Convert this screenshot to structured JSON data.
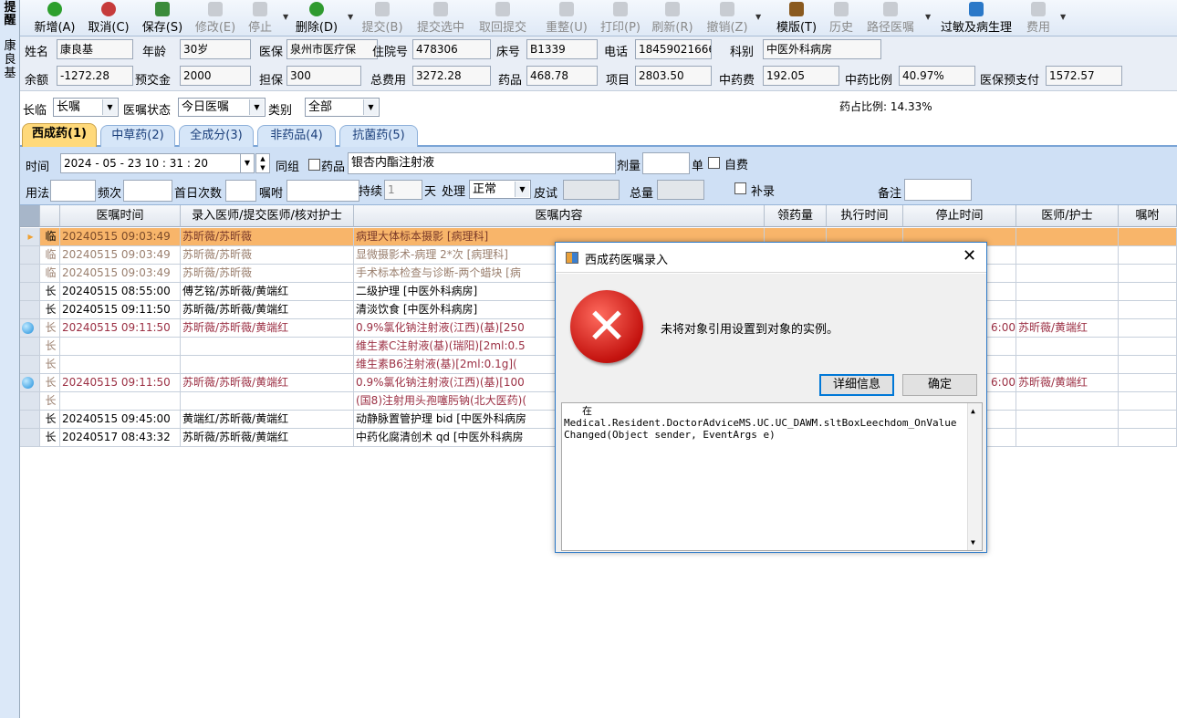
{
  "sidebar": {
    "chars_top": [
      "提",
      "醒"
    ],
    "patient_chars": [
      "康",
      "良",
      "基"
    ]
  },
  "toolbar": {
    "buttons": [
      {
        "label": "新增(A)",
        "color": "#2d9f2d"
      },
      {
        "label": "取消(C)",
        "color": "#c63b3b"
      },
      {
        "label": "保存(S)",
        "color": "#3a8b3a"
      },
      {
        "label": "修改(E)",
        "color": "#c8ccd2"
      },
      {
        "label": "停止",
        "color": "#c8ccd2"
      },
      {
        "label": "删除(D)",
        "color": "#2f9a2f"
      },
      {
        "label": "提交(B)",
        "color": "#c8ccd2"
      },
      {
        "label": "提交选中",
        "color": "#c8ccd2"
      },
      {
        "label": "取回提交",
        "color": "#c8ccd2"
      },
      {
        "label": "重整(U)",
        "color": "#c8ccd2"
      },
      {
        "label": "打印(P)",
        "color": "#c8ccd2"
      },
      {
        "label": "刷新(R)",
        "color": "#c8ccd2"
      },
      {
        "label": "撤销(Z)",
        "color": "#c8ccd2"
      },
      {
        "label": "模版(T)",
        "color": "#8a5a1f"
      },
      {
        "label": "历史",
        "color": "#c8ccd2"
      },
      {
        "label": "路径医嘱",
        "color": "#c8ccd2"
      },
      {
        "label": "过敏及病生理",
        "color": "#2a78c8"
      },
      {
        "label": "费用",
        "color": "#c8ccd2"
      }
    ]
  },
  "patient": {
    "name_label": "姓名",
    "name": "康良基",
    "age_label": "年龄",
    "age": "30岁",
    "insurance_label": "医保",
    "insurance": "泉州市医疗保",
    "admission_label": "住院号",
    "admission_no": "478306",
    "bed_label": "床号",
    "bed": "B1339",
    "phone_label": "电话",
    "phone": "18459021666",
    "dept_label": "科别",
    "dept": "中医外科病房",
    "balance_label": "余额",
    "balance": "-1272.28",
    "deposit_label": "预交金",
    "deposit": "2000",
    "guarantee_label": "担保",
    "guarantee": "300",
    "total_label": "总费用",
    "total": "3272.28",
    "drug_label": "药品",
    "drug": "468.78",
    "item_label": "项目",
    "item": "2803.50",
    "tcm_label": "中药费",
    "tcm": "192.05",
    "tcm_ratio_label": "中药比例",
    "tcm_ratio": "40.97%",
    "prepay_label": "医保预支付",
    "prepay": "1572.57"
  },
  "filter": {
    "type_label": "长临",
    "type_value": "长嘱",
    "status_label": "医嘱状态",
    "status_value": "今日医嘱",
    "category_label": "类别",
    "category_value": "全部",
    "drug_ratio": "药占比例: 14.33%"
  },
  "tabs": [
    "西成药(1)",
    "中草药(2)",
    "全成分(3)",
    "非药品(4)",
    "抗菌药(5)"
  ],
  "entry": {
    "time_label": "时间",
    "time_value": "2024 - 05 - 23    10 : 31 : 20",
    "group_label": "同组",
    "drug_label": "药品",
    "drug_value": "银杏内酯注射液",
    "dose_label": "剂量",
    "unit_label": "单",
    "selfpay_label": "自费",
    "usage_label": "用法",
    "freq_label": "频次",
    "firstday_label": "首日次数",
    "remark_label": "嘱咐",
    "duration_label": "持续",
    "duration_value": "1",
    "day_label": "天",
    "handle_label": "处理",
    "handle_value": "正常",
    "skintest_label": "皮试",
    "total_label": "总量",
    "supplement_label": "补录",
    "note_label": "备注"
  },
  "grid": {
    "headers": [
      "",
      "",
      "医嘱时间",
      "录入医师/提交医师/核对护士",
      "医嘱内容",
      "领药量",
      "执行时间",
      "停止时间",
      "医师/护士",
      "嘱咐"
    ],
    "rows": [
      {
        "type": "临",
        "time": "20240515 09:03:49",
        "doctor": "苏昕薇/苏昕薇",
        "content": "病理大体标本摄影  [病理科]",
        "selected": true
      },
      {
        "type": "临",
        "time": "20240515 09:03:49",
        "doctor": "苏昕薇/苏昕薇",
        "content": "显微摄影术-病理  2*次  [病理科]",
        "gray": true
      },
      {
        "type": "临",
        "time": "20240515 09:03:49",
        "doctor": "苏昕薇/苏昕薇",
        "content": "手术标本检查与诊断-两个蜡块  [病",
        "gray": true
      },
      {
        "type": "长",
        "time": "20240515 08:55:00",
        "doctor": "傅艺铭/苏昕薇/黄端红",
        "content": "二级护理  [中医外科病房]"
      },
      {
        "type": "长",
        "time": "20240515 09:11:50",
        "doctor": "苏昕薇/苏昕薇/黄端红",
        "content": "清淡饮食  [中医外科病房]"
      },
      {
        "type": "长",
        "time": "20240515 09:11:50",
        "doctor": "苏昕薇/苏昕薇/黄端红",
        "content": "0.9%氯化钠注射液(江西)(基)[250",
        "maroon": true,
        "bullet": true,
        "nurse": "苏昕薇/黄端红",
        "stop": "6:00"
      },
      {
        "type": "长",
        "time": "",
        "doctor": "",
        "content": "维生素C注射液(基)(瑞阳)[2ml:0.5",
        "maroon": true
      },
      {
        "type": "长",
        "time": "",
        "doctor": "",
        "content": "维生素B6注射液(基)[2ml:0.1g](",
        "maroon": true
      },
      {
        "type": "长",
        "time": "20240515 09:11:50",
        "doctor": "苏昕薇/苏昕薇/黄端红",
        "content": "0.9%氯化钠注射液(江西)(基)[100",
        "maroon": true,
        "bullet": true,
        "nurse": "苏昕薇/黄端红",
        "stop": "6:00"
      },
      {
        "type": "长",
        "time": "",
        "doctor": "",
        "content": "(国8)注射用头孢噻肟钠(北大医药)(",
        "maroon": true
      },
      {
        "type": "长",
        "time": "20240515 09:45:00",
        "doctor": "黄端红/苏昕薇/黄端红",
        "content": "动静脉置管护理 bid  [中医外科病房"
      },
      {
        "type": "长",
        "time": "20240517 08:43:32",
        "doctor": "苏昕薇/苏昕薇/黄端红",
        "content": "中药化腐清创术 qd  [中医外科病房"
      }
    ]
  },
  "dialog": {
    "title": "西成药医嘱录入",
    "message": "未将对象引用设置到对象的实例。",
    "details_button": "详细信息",
    "ok_button": "确定",
    "stack_line1": "在",
    "stack_line2": "Medical.Resident.DoctorAdviceMS.UC.UC_DAWM.sltBoxLeechdom_OnValue",
    "stack_line3": "Changed(Object sender, EventArgs e)"
  }
}
